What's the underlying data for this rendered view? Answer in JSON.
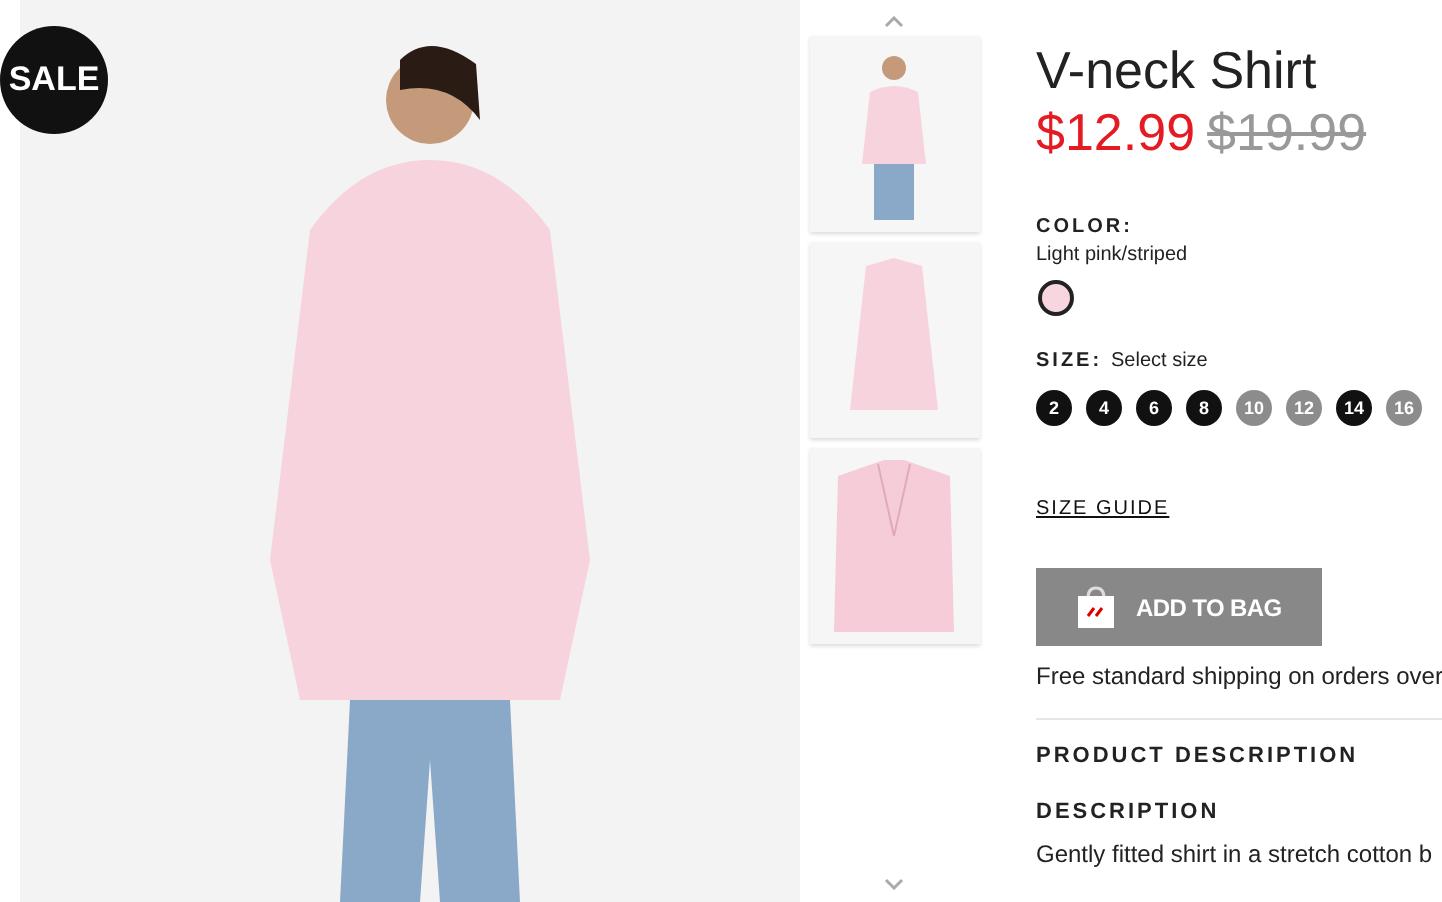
{
  "badge": "SALE",
  "thumbnails": [
    {
      "kind": "model"
    },
    {
      "kind": "flat"
    },
    {
      "kind": "detail"
    }
  ],
  "product": {
    "title": "V-neck Shirt",
    "price": "$12.99",
    "old_price": "$19.99",
    "color_label": "COLOR:",
    "color_name": "Light pink/striped",
    "swatches": [
      {
        "color": "#f7d6e0",
        "selected": true
      }
    ],
    "size_label": "SIZE:",
    "size_hint": "Select size",
    "sizes": [
      {
        "label": "2",
        "available": true
      },
      {
        "label": "4",
        "available": true
      },
      {
        "label": "6",
        "available": true
      },
      {
        "label": "8",
        "available": true
      },
      {
        "label": "10",
        "available": false
      },
      {
        "label": "12",
        "available": false
      },
      {
        "label": "14",
        "available": true
      },
      {
        "label": "16",
        "available": false
      }
    ],
    "size_guide": "SIZE GUIDE",
    "add_button": "ADD TO BAG",
    "shipping": "Free standard shipping on orders over",
    "section_title": "PRODUCT DESCRIPTION",
    "description_title": "DESCRIPTION",
    "description": "Gently fitted shirt in a stretch cotton b"
  }
}
